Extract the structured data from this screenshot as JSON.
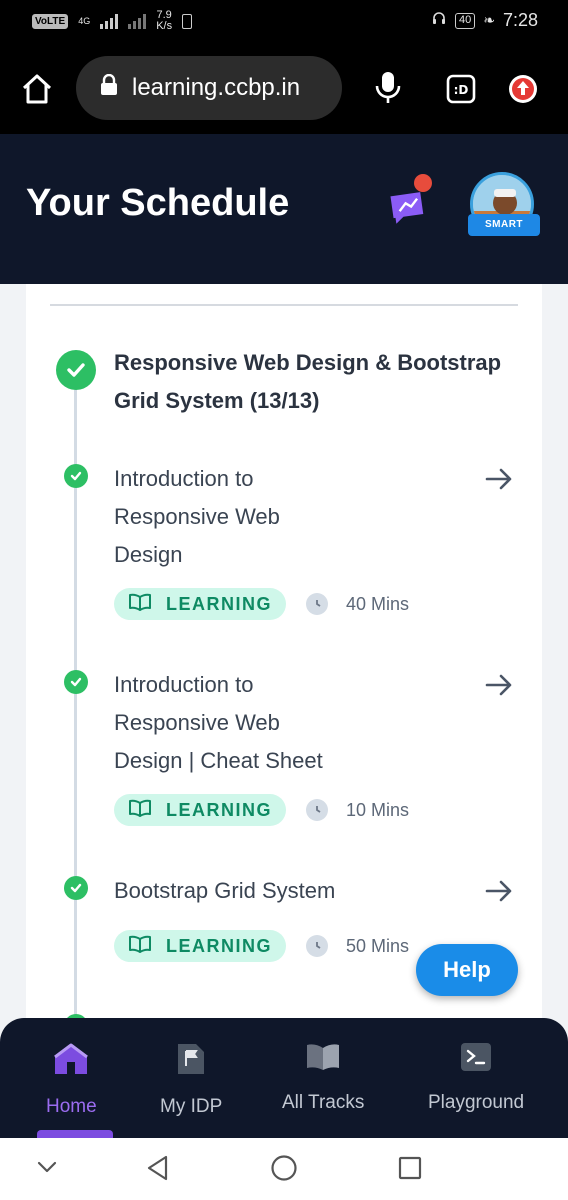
{
  "status_bar": {
    "volte": "VoLTE",
    "network": "4G",
    "speed_value": "7.9",
    "speed_unit": "K/s",
    "battery": "40",
    "time": "7:28"
  },
  "browser": {
    "url": "learning.ccbp.in",
    "icons": [
      "home-icon",
      "lock-icon",
      "mic-icon",
      "tab-switcher-icon",
      "update-icon"
    ]
  },
  "header": {
    "title": "Your Schedule",
    "avatar_badge": "SMART",
    "colors": {
      "background": "#0f172a",
      "notification_dot": "#e74c3c",
      "chat_icon": "#8b5cf6"
    }
  },
  "schedule": {
    "section": {
      "title": "Responsive Web Design & Bootstrap Grid System (13/13)"
    },
    "items": [
      {
        "title_lines": [
          "Introduction to",
          "Responsive Web",
          "Design"
        ],
        "tag": "LEARNING",
        "duration": "40 Mins"
      },
      {
        "title_lines": [
          "Introduction to",
          "Responsive Web",
          "Design | Cheat Sheet"
        ],
        "tag": "LEARNING",
        "duration": "10 Mins"
      },
      {
        "title_lines": [
          "Bootstrap Grid System"
        ],
        "tag": "LEARNING",
        "duration": "50 Mins"
      }
    ],
    "colors": {
      "check": "#2dbf64",
      "tag_bg": "#cff7ea",
      "tag_text": "#0e8a63"
    }
  },
  "help_button": {
    "label": "Help",
    "color": "#1a8ce8"
  },
  "bottom_nav": {
    "items": [
      {
        "label": "Home",
        "icon": "home-icon",
        "active": true
      },
      {
        "label": "My IDP",
        "icon": "flag-document-icon",
        "active": false
      },
      {
        "label": "All Tracks",
        "icon": "open-book-icon",
        "active": false
      },
      {
        "label": "Playground",
        "icon": "terminal-icon",
        "active": false
      }
    ],
    "active_color": "#9b6cf0"
  },
  "system_nav": {
    "icons": [
      "chevron-down-icon",
      "back-icon",
      "home-circle-icon",
      "recents-icon"
    ]
  }
}
